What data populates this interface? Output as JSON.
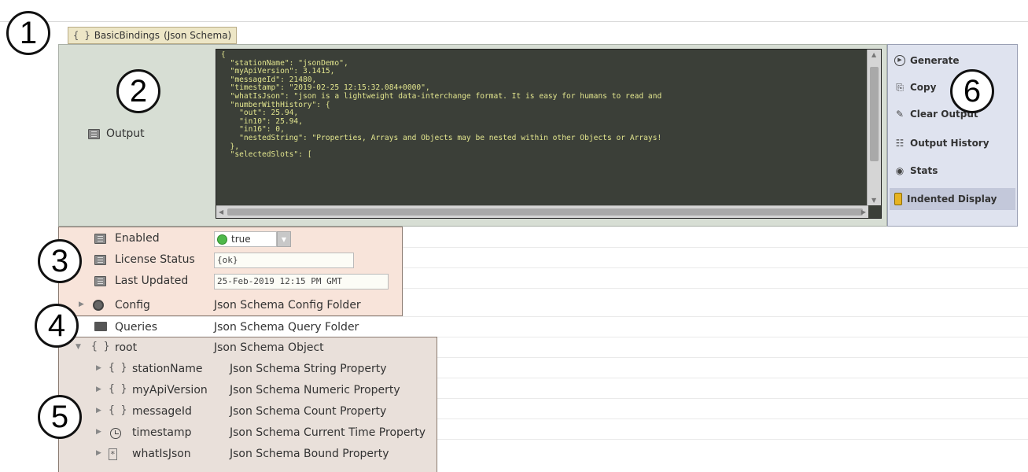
{
  "callouts": [
    "1",
    "2",
    "3",
    "4",
    "5",
    "6"
  ],
  "component": {
    "title": "BasicBindings",
    "type": "(Json Schema)"
  },
  "output": {
    "label": "Output",
    "code": "{\n  \"stationName\": \"jsonDemo\",\n  \"myApiVersion\": 3.1415,\n  \"messageId\": 21480,\n  \"timestamp\": \"2019-02-25 12:15:32.084+0000\",\n  \"whatIsJson\": \"json is a lightweight data-interchange format. It is easy for humans to read and\n  \"numberWithHistory\": {\n    \"out\": 25.94,\n    \"in10\": 25.94,\n    \"in16\": 0,\n    \"nestedString\": \"Properties, Arrays and Objects may be nested within other Objects or Arrays!\n  },\n  \"selectedSlots\": ["
  },
  "actions": [
    {
      "label": "Generate",
      "icon": "play-circle-icon"
    },
    {
      "label": "Copy",
      "icon": "copy-icon"
    },
    {
      "label": "Clear Output",
      "icon": "eraser-icon"
    },
    {
      "label": "Output History",
      "icon": "history-grid-icon"
    },
    {
      "label": "Stats",
      "icon": "eye-icon"
    },
    {
      "label": "Indented Display",
      "icon": "toggle-icon",
      "active": true
    }
  ],
  "properties": {
    "enabled": {
      "label": "Enabled",
      "value": "true",
      "status_color": "#4eb84a"
    },
    "license": {
      "label": "License Status",
      "value": "{ok}"
    },
    "updated": {
      "label": "Last Updated",
      "value": "25-Feb-2019 12:15 PM GMT"
    },
    "config": {
      "label": "Config",
      "value": "Json Schema Config Folder"
    },
    "queries": {
      "label": "Queries",
      "value": "Json Schema Query Folder"
    },
    "root": {
      "label": "root",
      "value": "Json Schema Object"
    }
  },
  "children": [
    {
      "label": "stationName",
      "value": "Json Schema String Property",
      "icon": "braces-icon"
    },
    {
      "label": "myApiVersion",
      "value": "Json Schema Numeric Property",
      "icon": "braces-icon"
    },
    {
      "label": "messageId",
      "value": "Json Schema Count Property",
      "icon": "braces-icon"
    },
    {
      "label": "timestamp",
      "value": "Json Schema Current Time Property",
      "icon": "clock-icon"
    },
    {
      "label": "whatIsJson",
      "value": "Json Schema Bound Property",
      "icon": "bound-icon"
    }
  ]
}
